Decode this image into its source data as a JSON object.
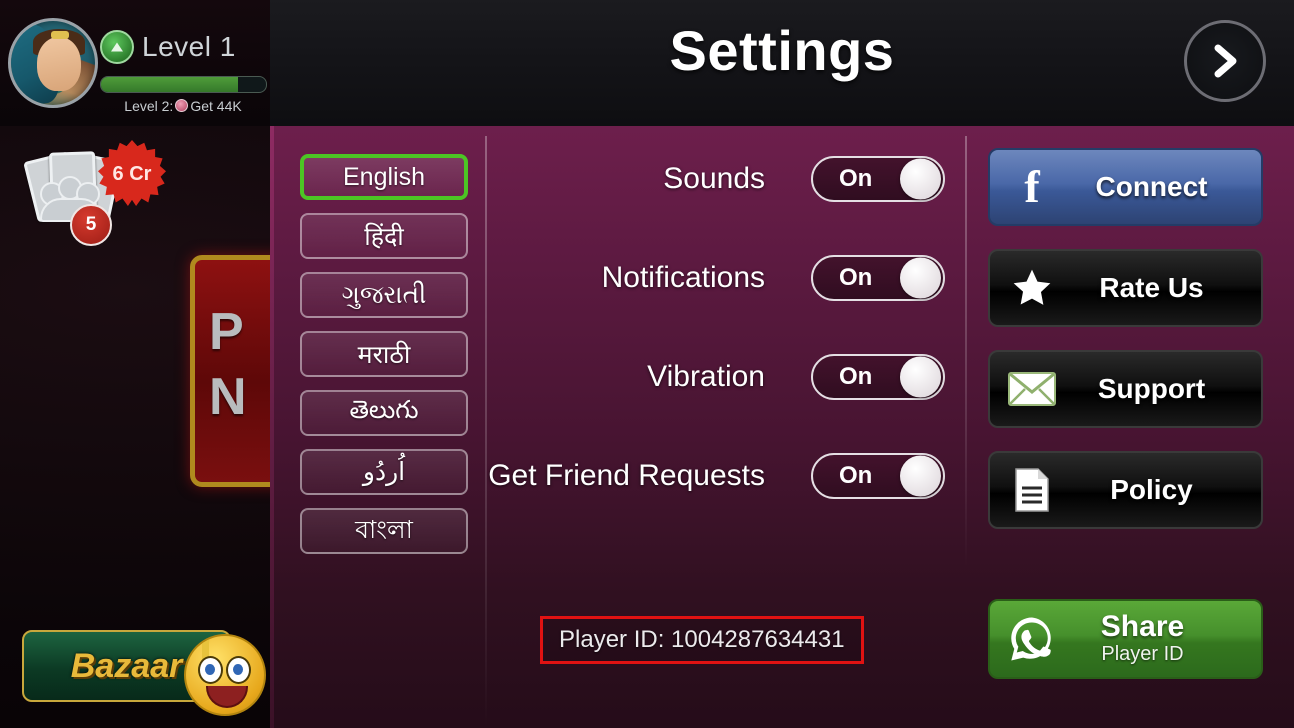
{
  "hud": {
    "level_label": "Level 1",
    "next_level_text_prefix": "Level 2:",
    "next_level_text_suffix": "Get 44K",
    "xp_percent": 83,
    "players_count": "5",
    "coins_badge": "6 Cr",
    "bazaar_label": "Bazaar",
    "hidden_panel_text": "P\nN"
  },
  "header": {
    "title": "Settings",
    "close_icon": "chevron-right-icon"
  },
  "languages": [
    {
      "label": "English",
      "selected": true
    },
    {
      "label": "हिंदी",
      "selected": false
    },
    {
      "label": "ગુજરાતી",
      "selected": false
    },
    {
      "label": "मराठी",
      "selected": false
    },
    {
      "label": "తెలుగు",
      "selected": false
    },
    {
      "label": "اُردُو",
      "selected": false
    },
    {
      "label": "বাংলা",
      "selected": false
    }
  ],
  "options": [
    {
      "label": "Sounds",
      "value": "On"
    },
    {
      "label": "Notifications",
      "value": "On"
    },
    {
      "label": "Vibration",
      "value": "On"
    },
    {
      "label": "Get Friend Requests",
      "value": "On"
    }
  ],
  "player_id": "Player ID: 1004287634431",
  "actions": [
    {
      "label": "Connect",
      "icon": "facebook-icon",
      "style": "fb"
    },
    {
      "label": "Rate Us",
      "icon": "star-icon",
      "style": "dark"
    },
    {
      "label": "Support",
      "icon": "envelope-icon",
      "style": "dark"
    },
    {
      "label": "Policy",
      "icon": "document-icon",
      "style": "dark"
    }
  ],
  "share": {
    "title": "Share",
    "subtitle": "Player ID",
    "icon": "whatsapp-icon"
  },
  "colors": {
    "selected_language_border": "#4cc524",
    "panel_top": "#6d1f4c",
    "panel_bottom": "#250c19",
    "facebook_blue": "#3b5998",
    "whatsapp_green": "#35771f",
    "annotation_red": "#e01212"
  }
}
